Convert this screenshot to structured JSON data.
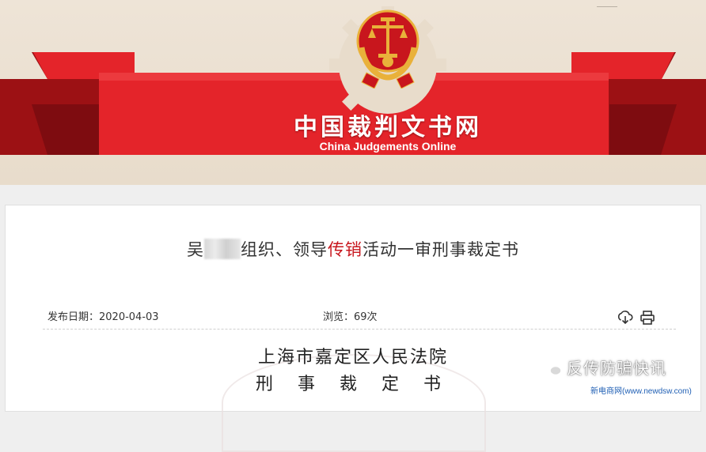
{
  "banner": {
    "title": "中国裁判文书网",
    "subtitle": "China Judgements Online",
    "colors": {
      "red": "#e4242a",
      "dark_red": "#9c1114",
      "gold": "#e9b13a",
      "background": "#eee4d7"
    },
    "emblem": "court-emblem-icon"
  },
  "document": {
    "title_prefix": "吴",
    "title_middle": "组织、领导",
    "title_keyword": "传销",
    "title_suffix": "活动一审刑事裁定书",
    "publish_date": "发布日期：2020-04-03",
    "views": "浏览：69次",
    "court_name": "上海市嘉定区人民法院",
    "doc_type": "刑 事 裁 定 书",
    "tools": [
      "download-icon",
      "print-icon"
    ],
    "keyword_color": "#c8161d"
  },
  "watermark": {
    "brand": "反传防骗快讯",
    "site": "新电商网(www.newdsw.com)",
    "icon": "wechat-icon"
  }
}
